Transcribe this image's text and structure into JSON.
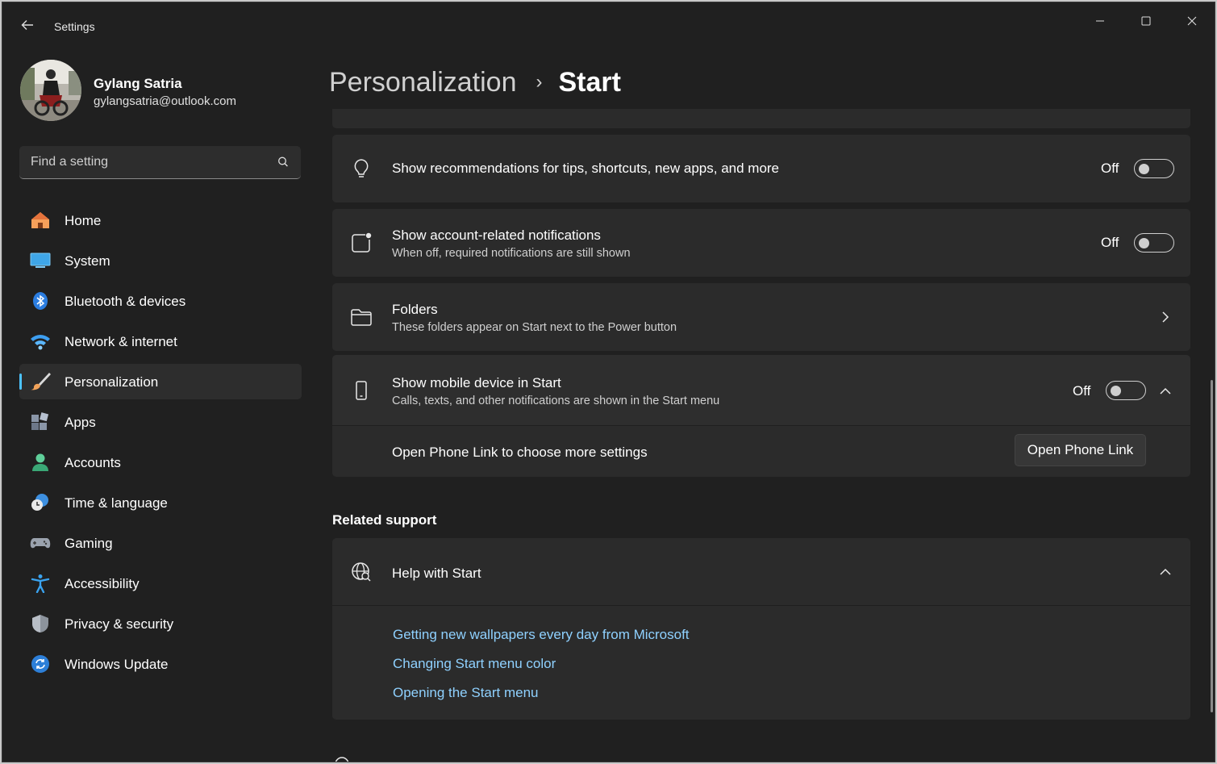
{
  "window": {
    "title": "Settings"
  },
  "user": {
    "name": "Gylang Satria",
    "email": "gylangsatria@outlook.com"
  },
  "search": {
    "placeholder": "Find a setting"
  },
  "nav": [
    {
      "label": "Home",
      "icon": "home-icon"
    },
    {
      "label": "System",
      "icon": "system-icon"
    },
    {
      "label": "Bluetooth & devices",
      "icon": "bluetooth-icon"
    },
    {
      "label": "Network & internet",
      "icon": "wifi-icon"
    },
    {
      "label": "Personalization",
      "icon": "brush-icon",
      "active": true
    },
    {
      "label": "Apps",
      "icon": "apps-icon"
    },
    {
      "label": "Accounts",
      "icon": "accounts-icon"
    },
    {
      "label": "Time & language",
      "icon": "clock-globe-icon"
    },
    {
      "label": "Gaming",
      "icon": "controller-icon"
    },
    {
      "label": "Accessibility",
      "icon": "accessibility-icon"
    },
    {
      "label": "Privacy & security",
      "icon": "shield-icon"
    },
    {
      "label": "Windows Update",
      "icon": "update-icon"
    }
  ],
  "breadcrumb": {
    "parent": "Personalization",
    "separator": "›",
    "current": "Start"
  },
  "settings": {
    "recommendations": {
      "title": "Show recommendations for tips, shortcuts, new apps, and more",
      "state": "Off"
    },
    "account_notifications": {
      "title": "Show account-related notifications",
      "subtitle": "When off, required notifications are still shown",
      "state": "Off"
    },
    "folders": {
      "title": "Folders",
      "subtitle": "These folders appear on Start next to the Power button"
    },
    "mobile_device": {
      "title": "Show mobile device in Start",
      "subtitle": "Calls, texts, and other notifications are shown in the Start menu",
      "state": "Off"
    },
    "phone_link": {
      "text": "Open Phone Link to choose more settings",
      "button": "Open Phone Link"
    }
  },
  "related_support": {
    "title": "Related support",
    "help": {
      "title": "Help with Start"
    },
    "links": [
      "Getting new wallpapers every day from Microsoft",
      "Changing Start menu color",
      "Opening the Start menu"
    ]
  },
  "colors": {
    "accent": "#4cc2ff",
    "link": "#8fd1ff",
    "card": "#2b2b2b",
    "background": "#202020"
  }
}
